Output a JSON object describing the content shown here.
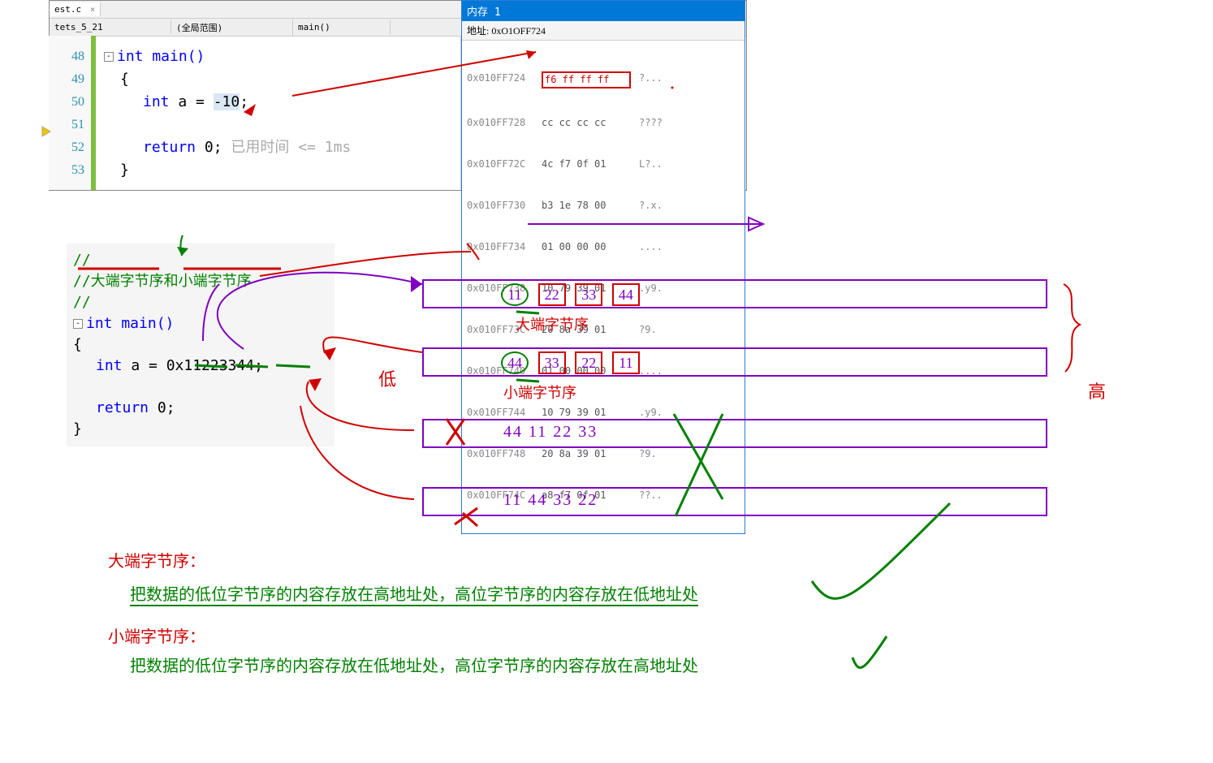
{
  "ide": {
    "tab_label": "est.c",
    "combo_left": "tets_5_21",
    "combo_mid": "(全局范围)",
    "combo_right": "main()",
    "lines": [
      "48",
      "49",
      "50",
      "51",
      "52",
      "53"
    ],
    "code": {
      "l48": "int main()",
      "l49": "{",
      "l50a": "int",
      "l50b": " a = ",
      "l50c": "-10",
      "l50d": ";",
      "l51": "",
      "l52a": "return",
      "l52b": " 0;",
      "l52c": "  已用时间 <= 1ms",
      "l53": "}"
    }
  },
  "memory": {
    "title": "内存 1",
    "addr_label": "地址:",
    "addr_value": "0xO1OFF724",
    "rows": [
      {
        "a": "0x010FF724",
        "b": "f6 ff ff ff",
        "c": "?..."
      },
      {
        "a": "0x010FF728",
        "b": "cc cc cc cc",
        "c": "????"
      },
      {
        "a": "0x010FF72C",
        "b": "4c f7 0f 01",
        "c": "L?.."
      },
      {
        "a": "0x010FF730",
        "b": "b3 1e 78 00",
        "c": "?.x."
      },
      {
        "a": "0x010FF734",
        "b": "01 00 00 00",
        "c": "...."
      },
      {
        "a": "0x010FF738",
        "b": "10 79 39 01",
        "c": ".y9."
      },
      {
        "a": "0x010FF73C",
        "b": "20 8a 39 01",
        "c": "?9."
      },
      {
        "a": "0x010FF740",
        "b": "01 00 00 00",
        "c": "...."
      },
      {
        "a": "0x010FF744",
        "b": "10 79 39 01",
        "c": ".y9."
      },
      {
        "a": "0x010FF748",
        "b": "20 8a 39 01",
        "c": "?9."
      },
      {
        "a": "0x010FF74C",
        "b": "a8 f7 0f 01",
        "c": "??.."
      }
    ]
  },
  "code2": {
    "c1": "//",
    "c2": "//大端字节序和小端字节序",
    "c3": "//",
    "l1": "int main()",
    "l2": "{",
    "l3a": "int",
    "l3b": " a = 0x11223344;",
    "l4": "",
    "l5a": "return",
    "l5b": " 0;",
    "l6": "}"
  },
  "lanes": {
    "big": {
      "b": [
        "11",
        "22",
        "33",
        "44"
      ],
      "label": "大端字节序"
    },
    "little": {
      "b": [
        "44",
        "33",
        "22",
        "11"
      ],
      "label": "小端字节序"
    },
    "bad1": "44  11  22  33",
    "bad2": "11  44  33  22",
    "low": "低",
    "high": "高"
  },
  "expl": {
    "t1": "大端字节序：",
    "t2": "把数据的低位字节序的内容存放在高地址处，高位字节序的内容存放在低地址处",
    "t3": "小端字节序：",
    "t4": "把数据的低位字节序的内容存放在低地址处，高位字节序的内容存放在高地址处"
  }
}
